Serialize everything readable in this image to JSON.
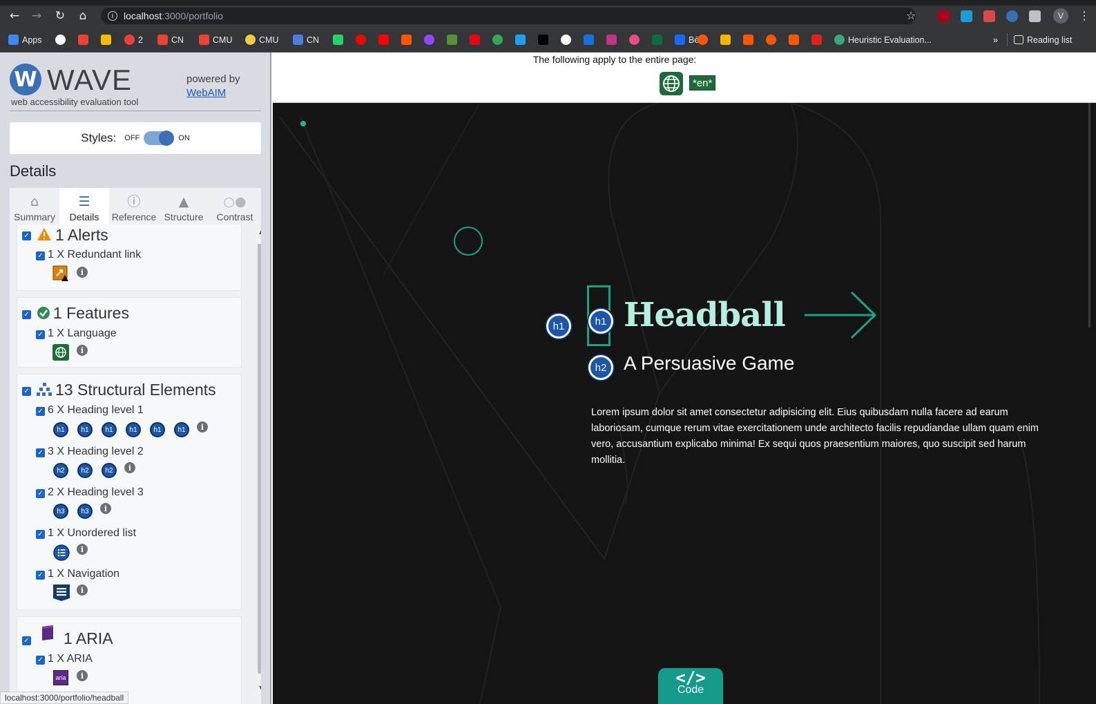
{
  "browser": {
    "url_host": "localhost",
    "url_path": ":3000/portfolio",
    "profile_initial": "V",
    "bookmarks": [
      {
        "label": "Apps",
        "color": "#4285f4"
      },
      {
        "label": "",
        "color": "#ffffff"
      },
      {
        "label": "",
        "color": "#ea4335"
      },
      {
        "label": "",
        "color": "#fbbc04"
      },
      {
        "label": "2",
        "color": "#ea4335"
      },
      {
        "label": "CN",
        "color": "#ea4335"
      },
      {
        "label": "CMU",
        "color": "#ea4335"
      },
      {
        "label": "CMU",
        "color": "#f7c948"
      },
      {
        "label": "CN",
        "color": "#4e7de0"
      },
      {
        "label": "",
        "color": "#25d366"
      },
      {
        "label": "",
        "color": "#ff0000"
      },
      {
        "label": "",
        "color": "#ff0000"
      },
      {
        "label": "",
        "color": "#ff5700"
      },
      {
        "label": "",
        "color": "#9146ff"
      },
      {
        "label": "",
        "color": "#5c8f3a"
      },
      {
        "label": "",
        "color": "#e50914"
      },
      {
        "label": "",
        "color": "#34a853"
      },
      {
        "label": "",
        "color": "#1da1f2"
      },
      {
        "label": "",
        "color": "#000000"
      },
      {
        "label": "",
        "color": "#ffffff"
      },
      {
        "label": "",
        "color": "#1b6fe0"
      },
      {
        "label": "",
        "color": "#c13584"
      },
      {
        "label": "",
        "color": "#ea4c89"
      },
      {
        "label": "",
        "color": "#0c6b3f"
      },
      {
        "label": "Bē",
        "color": "#1769ff"
      },
      {
        "label": "",
        "color": "#ff5700"
      },
      {
        "label": "",
        "color": "#f7b500"
      },
      {
        "label": "",
        "color": "#ff5700"
      },
      {
        "label": "",
        "color": "#ff5700"
      },
      {
        "label": "",
        "color": "#ff5700"
      },
      {
        "label": "",
        "color": "#e2231a"
      },
      {
        "label": "Heuristic Evaluation...",
        "color": "#3aa67a"
      }
    ],
    "more_label": "»",
    "reading_list": "Reading list",
    "status_url": "localhost:3000/portfolio/headball"
  },
  "wave": {
    "title": "WAVE",
    "subtitle": "web accessibility evaluation tool",
    "powered_by": "powered by",
    "webaim": "WebAIM",
    "styles_label": "Styles:",
    "off": "OFF",
    "on": "ON",
    "details_heading": "Details",
    "tabs": [
      "Summary",
      "Details",
      "Reference",
      "Structure",
      "Contrast"
    ],
    "groups": {
      "alerts": {
        "title": "1 Alerts",
        "items": [
          "1 X Redundant link"
        ]
      },
      "features": {
        "title": "1 Features",
        "items": [
          "1 X Language"
        ]
      },
      "structural": {
        "title": "13 Structural Elements",
        "items": [
          "6 X Heading level 1",
          "3 X Heading level 2",
          "2 X Heading level 3",
          "1 X Unordered list",
          "1 X Navigation"
        ]
      },
      "aria": {
        "title": "1 ARIA",
        "items": [
          "1 X ARIA"
        ]
      }
    },
    "badges": {
      "h1": "h1",
      "h2": "h2",
      "h3": "h3",
      "aria": "aria"
    },
    "info": "i"
  },
  "page": {
    "note": "The following apply to the entire page:",
    "lang_badge": "*en*",
    "title": "Headball",
    "subtitle": "A Persuasive Game",
    "body": "Lorem ipsum dolor sit amet consectetur adipisicing elit. Eius quibusdam nulla facere ad earum laboriosam, cumque rerum vitae exercitationem unde architecto facilis repudiandae ullam quam enim vero, accusantium explicabo minima! Ex sequi quos praesentium maiores, quo suscipit sed harum mollitia.",
    "code_symbol": "</>",
    "code_label": "Code",
    "accent": "#1aa38a"
  }
}
